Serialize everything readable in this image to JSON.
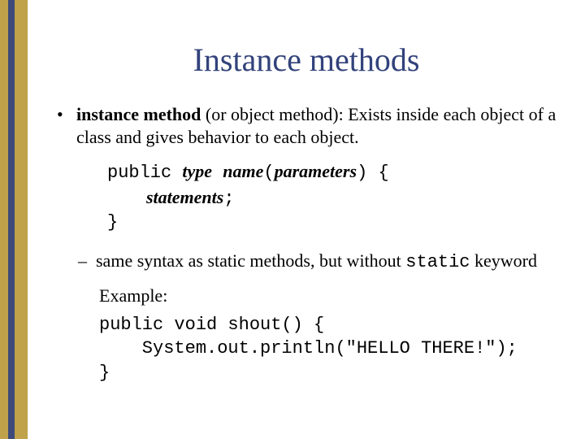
{
  "title": "Instance methods",
  "bullet1": {
    "term": "instance method",
    "aka": " (or object method): ",
    "defn": "Exists inside each object of a class and gives behavior to each object."
  },
  "template": {
    "kw_public": "public ",
    "type": "type",
    "sp1": " ",
    "name": "name",
    "lparen": "(",
    "params": "parameters",
    "rparen_brace": ") {",
    "statements": "statements",
    "semicolon": ";",
    "close": "}"
  },
  "bullet2": {
    "pre": "same syntax as static methods, but without ",
    "kw_static": "static",
    "post": " keyword"
  },
  "example_label": "Example:",
  "example_code": "public void shout() {\n    System.out.println(\"HELLO THERE!\");\n}"
}
